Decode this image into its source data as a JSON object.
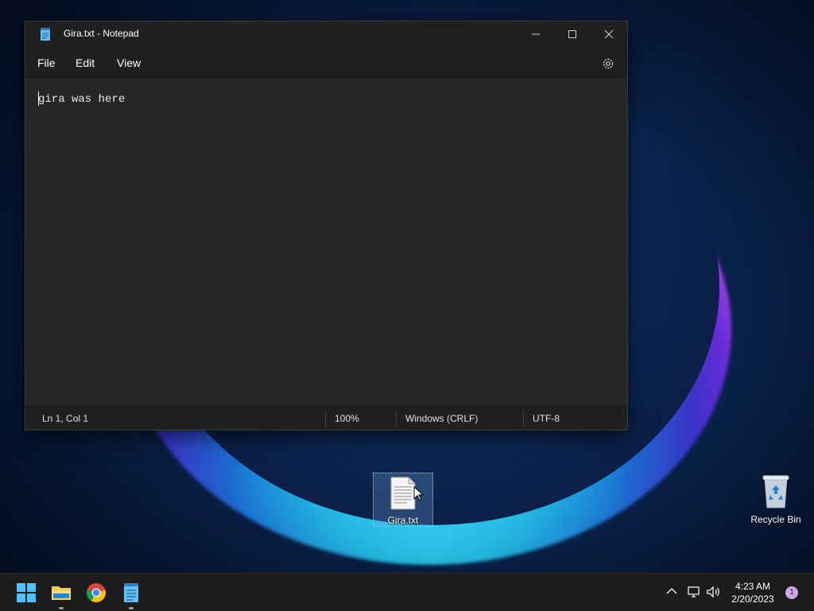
{
  "notepad": {
    "title": "Gira.txt - Notepad",
    "controls": {
      "minimize_icon": "minimize-icon",
      "maximize_icon": "maximize-icon",
      "close_icon": "close-icon"
    },
    "menu": [
      "File",
      "Edit",
      "View"
    ],
    "content": "gira was here",
    "status": {
      "position": "Ln 1, Col 1",
      "zoom": "100%",
      "line_ending": "Windows (CRLF)",
      "encoding": "UTF-8"
    }
  },
  "desktop": {
    "icons": [
      {
        "label": "Gira.txt",
        "icon": "text-file-icon",
        "selected": true
      },
      {
        "label": "Recycle Bin",
        "icon": "recycle-bin-icon",
        "selected": false
      }
    ]
  },
  "taskbar": {
    "apps": [
      "start-icon",
      "file-explorer-icon",
      "chrome-icon",
      "notepad-icon"
    ],
    "tray": {
      "time": "4:23 AM",
      "date": "2/20/2023",
      "notifications": "1"
    }
  },
  "colors": {
    "window_bg": "#202020",
    "editor_bg": "#272727",
    "taskbar_bg": "#1c1c1c",
    "accent": "#4cc2ff"
  }
}
